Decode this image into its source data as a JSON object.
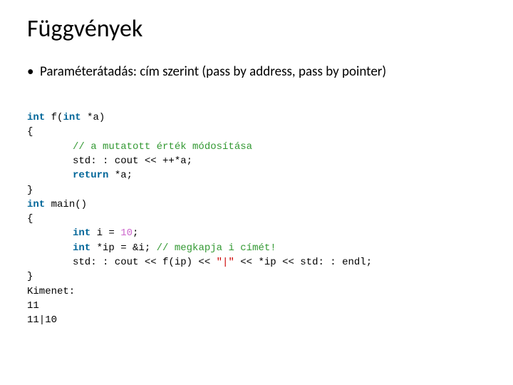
{
  "title": "Függvények",
  "bullet": "Paraméterátadás: cím szerint (pass by address, pass by pointer)",
  "code": {
    "l1_a": "int",
    "l1_b": " f(",
    "l1_c": "int",
    "l1_d": " *a)",
    "l2": "{",
    "l3_cm": "// a mutatott érték módosítása",
    "l4_a": "std: : cout << ++*a;",
    "l5_a": "return",
    "l5_b": " *a;",
    "l6": "}",
    "l7_a": "int",
    "l7_b": " main()",
    "l8": "{",
    "l9_a": "int",
    "l9_b": " i = ",
    "l9_c": "10",
    "l9_d": ";",
    "l10_a": "int",
    "l10_b": " *ip = &i; ",
    "l10_c": "// megkapja i címét!",
    "l11_a": "std: : cout << f(ip) << ",
    "l11_b": "\"|\"",
    "l11_c": " << *ip << std: : endl;",
    "l12": "}",
    "l13": "Kimenet:",
    "l14": "11",
    "l15": "11|10"
  }
}
